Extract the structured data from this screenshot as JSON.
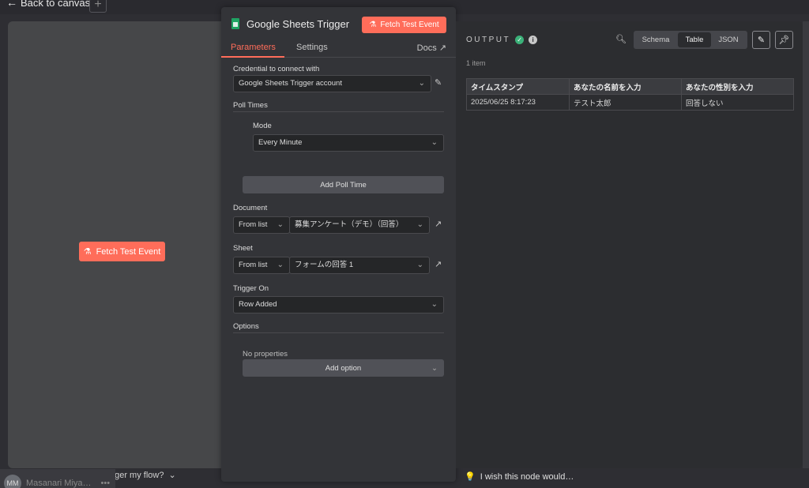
{
  "topbar": {
    "back_label": "Back to canvas",
    "back_icon": "arrow-left-icon",
    "add_icon": "plus-icon"
  },
  "left": {
    "fetch_label": "Fetch Test Event",
    "fetch_icon": "flask-icon",
    "trigger_help": "When will this node trigger my flow?"
  },
  "footer": {
    "avatar_initials": "MM",
    "user_name": "Masanari Miya…",
    "wish_text": "I wish this node would…",
    "wish_icon": "lightbulb-icon"
  },
  "node": {
    "title": "Google Sheets Trigger",
    "icon": "google-sheets-icon",
    "fetch_label": "Fetch Test Event",
    "tabs": {
      "parameters": "Parameters",
      "settings": "Settings",
      "docs": "Docs"
    },
    "credential": {
      "label": "Credential to connect with",
      "value": "Google Sheets Trigger account"
    },
    "poll": {
      "heading": "Poll Times",
      "mode_label": "Mode",
      "mode_value": "Every Minute",
      "add_label": "Add Poll Time"
    },
    "document": {
      "label": "Document",
      "source": "From list",
      "value": "募集アンケート（デモ）（回答）"
    },
    "sheet": {
      "label": "Sheet",
      "source": "From list",
      "value": "フォームの回答 1"
    },
    "trigger_on": {
      "label": "Trigger On",
      "value": "Row Added"
    },
    "options": {
      "heading": "Options",
      "empty": "No properties",
      "add_label": "Add option"
    }
  },
  "output": {
    "title": "OUTPUT",
    "status": "success",
    "views": {
      "schema": "Schema",
      "table": "Table",
      "json": "JSON"
    },
    "active_view": "Table",
    "count": "1 item",
    "columns": [
      "タイムスタンプ",
      "あなたの名前を入力",
      "あなたの性別を入力"
    ],
    "rows": [
      [
        "2025/06/25 8:17:23",
        "テスト太郎",
        "回答しない"
      ]
    ]
  },
  "colors": {
    "accent": "#ff6d5a",
    "success": "#3bb179",
    "sheets_green": "#1fa463"
  }
}
